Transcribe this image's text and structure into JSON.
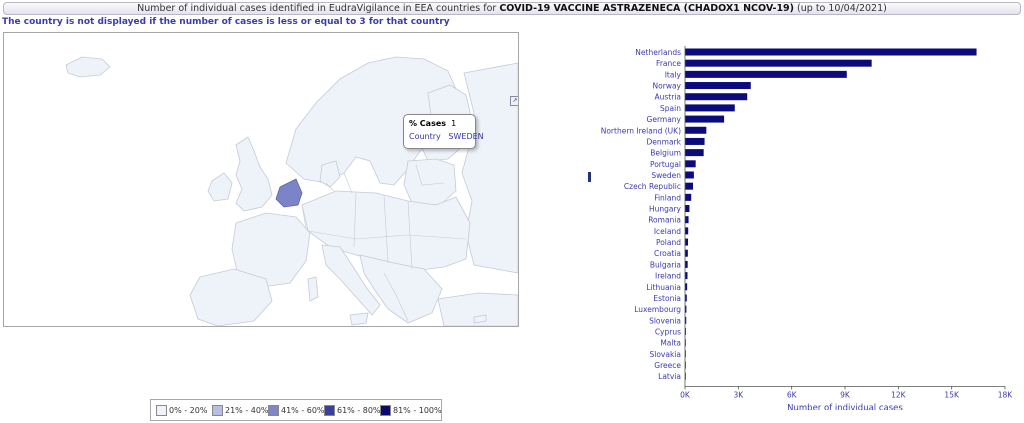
{
  "header": {
    "title_prefix": "Number of individual cases identified in EudraVigilance in EEA countries for",
    "title_product": "COVID-19 VACCINE ASTRAZENECA (CHADOX1 NCOV-19)",
    "title_suffix": "(up to 10/04/2021)"
  },
  "notice": "The country is not displayed if the number of cases is less or equal to 3 for that country",
  "map": {
    "tooltip": {
      "label1": "% Cases",
      "value1": "1",
      "label2": "Country",
      "value2": "SWEDEN"
    },
    "export_icon": "map-export-icon"
  },
  "legend": [
    {
      "label": "0% - 20%",
      "color": "#eef2fb"
    },
    {
      "label": "21% - 40%",
      "color": "#b9bde6"
    },
    {
      "label": "41% - 60%",
      "color": "#8086c8"
    },
    {
      "label": "61% - 80%",
      "color": "#3b3f9c"
    },
    {
      "label": "81% - 100%",
      "color": "#0a0a6e"
    }
  ],
  "colors": {
    "bar": "#0b0b7c",
    "label": "#3b3bb0",
    "map_land": "#eef2f9",
    "map_border": "#c4cad8",
    "netherlands": "#7b84c6"
  },
  "chart_data": {
    "type": "bar",
    "orientation": "horizontal",
    "xlabel": "Number of individual cases",
    "xlim": [
      0,
      18000
    ],
    "xticks": [
      0,
      3000,
      6000,
      9000,
      12000,
      15000,
      18000
    ],
    "xtick_labels": [
      "0K",
      "3K",
      "6K",
      "9K",
      "12K",
      "15K",
      "18K"
    ],
    "categories": [
      "Netherlands",
      "France",
      "Italy",
      "Norway",
      "Austria",
      "Spain",
      "Germany",
      "Northern Ireland (UK)",
      "Denmark",
      "Belgium",
      "Portugal",
      "Sweden",
      "Czech Republic",
      "Finland",
      "Hungary",
      "Romania",
      "Iceland",
      "Poland",
      "Croatia",
      "Bulgaria",
      "Ireland",
      "Lithuania",
      "Estonia",
      "Luxembourg",
      "Slovenia",
      "Cyprus",
      "Malta",
      "Slovakia",
      "Greece",
      "Latvia"
    ],
    "values": [
      16400,
      10500,
      9100,
      3700,
      3500,
      2800,
      2200,
      1200,
      1100,
      1050,
      600,
      500,
      450,
      350,
      250,
      200,
      180,
      170,
      160,
      150,
      140,
      120,
      100,
      80,
      70,
      50,
      40,
      30,
      20,
      10
    ],
    "grid": false,
    "legend": "none"
  }
}
